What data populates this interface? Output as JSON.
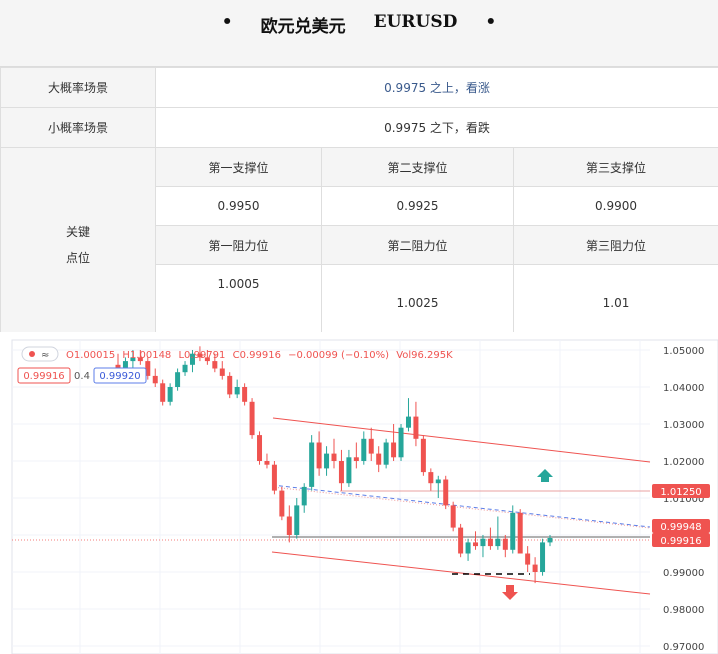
{
  "header": {
    "bullet_left": "•",
    "title": "欧元兑美元",
    "symbol": "EURUSD",
    "bullet_right": "•"
  },
  "scenarios": [
    {
      "label": "大概率场景",
      "value": "0.9975 之上，看涨"
    },
    {
      "label": "小概率场景",
      "value": "0.9975 之下，看跌"
    }
  ],
  "key_levels": {
    "label_line1": "关键",
    "label_line2": "点位",
    "support_headers": [
      "第一支撑位",
      "第二支撑位",
      "第三支撑位"
    ],
    "support_values": [
      "0.9950",
      "0.9925",
      "0.9900"
    ],
    "resistance_headers": [
      "第一阻力位",
      "第二阻力位",
      "第三阻力位"
    ],
    "resistance_values": [
      "1.0005",
      "1.0025",
      "1.01"
    ]
  },
  "chart": {
    "ohlc": {
      "o": "O1.00015",
      "h": "H1.00148",
      "l": "L0.99791",
      "c": "C0.99916",
      "chg": "−0.00099 (−0.10%)",
      "vol": "Vol96.295K"
    },
    "badges": {
      "sell": "0.99916",
      "spread": "0.4",
      "buy": "0.99920"
    },
    "price_tags": {
      "resistance": "1.01250",
      "upper": "0.99948",
      "current": "0.99916"
    },
    "colors": {
      "up": "#26a69a",
      "down": "#ef5350",
      "tag_red": "#e53935",
      "grid": "#f0f3fa"
    }
  },
  "chart_data": {
    "type": "candlestick",
    "y_ticks": [
      "1.05000",
      "1.04000",
      "1.03000",
      "1.02000",
      "1.01000",
      "1.00000",
      "0.99000",
      "0.98000",
      "0.97000"
    ],
    "ylim": [
      0.97,
      1.05
    ],
    "candles": [
      [
        1.046,
        1.049,
        1.044,
        1.045
      ],
      [
        1.045,
        1.048,
        1.044,
        1.047
      ],
      [
        1.047,
        1.05,
        1.045,
        1.048
      ],
      [
        1.048,
        1.05,
        1.046,
        1.047
      ],
      [
        1.047,
        1.048,
        1.042,
        1.043
      ],
      [
        1.043,
        1.045,
        1.04,
        1.041
      ],
      [
        1.041,
        1.042,
        1.035,
        1.036
      ],
      [
        1.036,
        1.041,
        1.035,
        1.04
      ],
      [
        1.04,
        1.045,
        1.039,
        1.044
      ],
      [
        1.044,
        1.047,
        1.043,
        1.046
      ],
      [
        1.046,
        1.05,
        1.044,
        1.049
      ],
      [
        1.049,
        1.051,
        1.047,
        1.048
      ],
      [
        1.048,
        1.05,
        1.046,
        1.047
      ],
      [
        1.047,
        1.049,
        1.044,
        1.045
      ],
      [
        1.045,
        1.047,
        1.042,
        1.043
      ],
      [
        1.043,
        1.044,
        1.037,
        1.038
      ],
      [
        1.038,
        1.042,
        1.037,
        1.04
      ],
      [
        1.04,
        1.041,
        1.035,
        1.036
      ],
      [
        1.036,
        1.037,
        1.026,
        1.027
      ],
      [
        1.027,
        1.028,
        1.019,
        1.02
      ],
      [
        1.02,
        1.022,
        1.018,
        1.019
      ],
      [
        1.019,
        1.02,
        1.011,
        1.012
      ],
      [
        1.012,
        1.013,
        1.004,
        1.005
      ],
      [
        1.005,
        1.008,
        0.998,
        1.0
      ],
      [
        1.0,
        1.01,
        0.999,
        1.008
      ],
      [
        1.008,
        1.014,
        1.006,
        1.013
      ],
      [
        1.013,
        1.027,
        1.012,
        1.025
      ],
      [
        1.025,
        1.028,
        1.016,
        1.018
      ],
      [
        1.018,
        1.024,
        1.016,
        1.022
      ],
      [
        1.022,
        1.026,
        1.018,
        1.02
      ],
      [
        1.02,
        1.023,
        1.012,
        1.014
      ],
      [
        1.014,
        1.023,
        1.013,
        1.021
      ],
      [
        1.021,
        1.025,
        1.018,
        1.02
      ],
      [
        1.02,
        1.028,
        1.019,
        1.026
      ],
      [
        1.026,
        1.029,
        1.02,
        1.022
      ],
      [
        1.022,
        1.024,
        1.017,
        1.019
      ],
      [
        1.019,
        1.026,
        1.018,
        1.025
      ],
      [
        1.025,
        1.03,
        1.02,
        1.021
      ],
      [
        1.021,
        1.03,
        1.02,
        1.029
      ],
      [
        1.029,
        1.037,
        1.028,
        1.032
      ],
      [
        1.032,
        1.036,
        1.024,
        1.026
      ],
      [
        1.026,
        1.027,
        1.016,
        1.017
      ],
      [
        1.017,
        1.018,
        1.012,
        1.014
      ],
      [
        1.014,
        1.016,
        1.01,
        1.015
      ],
      [
        1.015,
        1.016,
        1.007,
        1.008
      ],
      [
        1.008,
        1.009,
        1.001,
        1.002
      ],
      [
        1.002,
        1.003,
        0.994,
        0.995
      ],
      [
        0.995,
        0.999,
        0.993,
        0.998
      ],
      [
        0.998,
        1.001,
        0.996,
        0.997
      ],
      [
        0.997,
        1.0,
        0.994,
        0.999
      ],
      [
        0.999,
        1.002,
        0.996,
        0.997
      ],
      [
        0.997,
        1.005,
        0.996,
        0.999
      ],
      [
        0.999,
        1.0,
        0.994,
        0.996
      ],
      [
        0.996,
        1.008,
        0.995,
        1.006
      ],
      [
        1.006,
        1.007,
        0.995,
        0.995
      ],
      [
        0.995,
        0.997,
        0.99,
        0.992
      ],
      [
        0.992,
        0.994,
        0.987,
        0.99
      ],
      [
        0.99,
        0.999,
        0.989,
        0.998
      ],
      [
        0.998,
        1.0,
        0.997,
        0.9992
      ]
    ]
  }
}
